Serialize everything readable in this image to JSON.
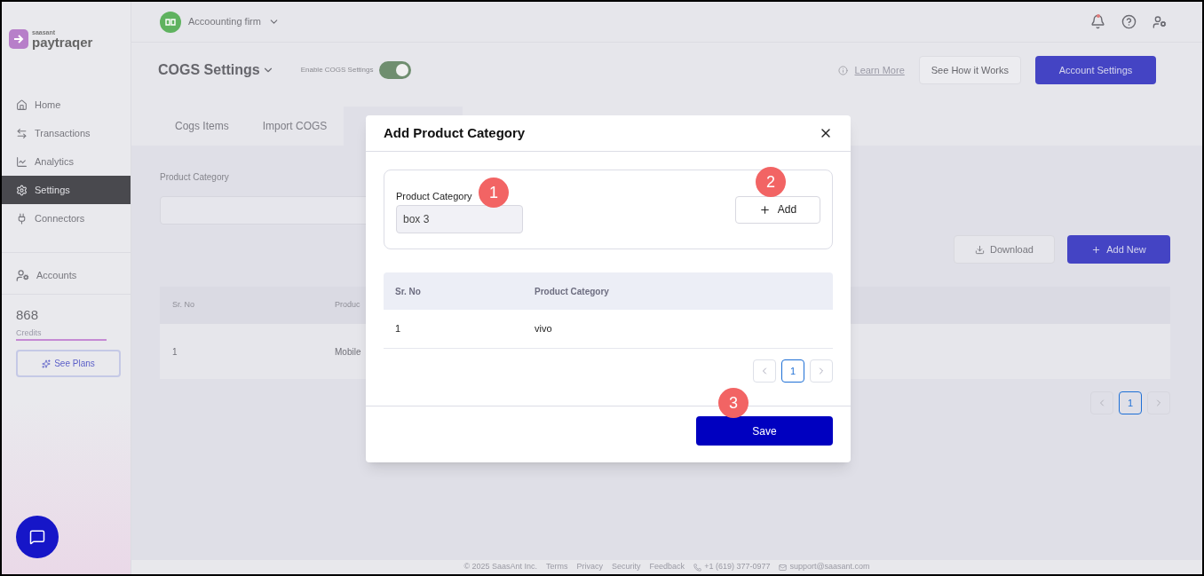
{
  "sidebar": {
    "logo": {
      "maker": "saasant",
      "brand": "paytraqer"
    },
    "nav": [
      {
        "label": "Home",
        "selected": false
      },
      {
        "label": "Transactions",
        "selected": false
      },
      {
        "label": "Analytics",
        "selected": false
      },
      {
        "label": "Settings",
        "selected": true
      },
      {
        "label": "Connectors",
        "selected": false
      }
    ],
    "accounts": "Accounts",
    "credits": {
      "value": "868",
      "label": "Credits"
    },
    "see_plans": "See Plans"
  },
  "topbar": {
    "company": "Accoounting firm"
  },
  "header": {
    "title": "COGS Settings",
    "toggle": {
      "label": "Enable COGS Settings",
      "on": true
    },
    "learn_more": "Learn More",
    "see_how": "See How it Works",
    "account_settings": "Account Settings"
  },
  "tabs": [
    {
      "label": "Cogs Items",
      "selected": false
    },
    {
      "label": "Import COGS",
      "selected": false
    }
  ],
  "page": {
    "field_label": "Product Category",
    "download": "Download",
    "add_new": "Add New",
    "table": {
      "columns": [
        "Sr. No",
        "Produc"
      ],
      "rows": [
        [
          "1",
          "Mobile"
        ]
      ]
    },
    "pagination": [
      {
        "label": "1",
        "selected": true
      }
    ]
  },
  "modal": {
    "title": "Add Product Category",
    "field_label": "Product Category",
    "field_value": "box 3",
    "add": "Add",
    "table": {
      "columns": [
        "Sr. No",
        "Product Category"
      ],
      "rows": [
        [
          "1",
          "vivo"
        ]
      ]
    },
    "pagination": [
      {
        "label": "1",
        "selected": true
      }
    ],
    "save": "Save",
    "markers": [
      "1",
      "2",
      "3"
    ]
  },
  "footer": [
    "© 2025 SaasAnt Inc.",
    "Terms",
    "Privacy",
    "Security",
    "Feedback",
    "+1 (619) 377-0977",
    "support@saasant.com"
  ]
}
